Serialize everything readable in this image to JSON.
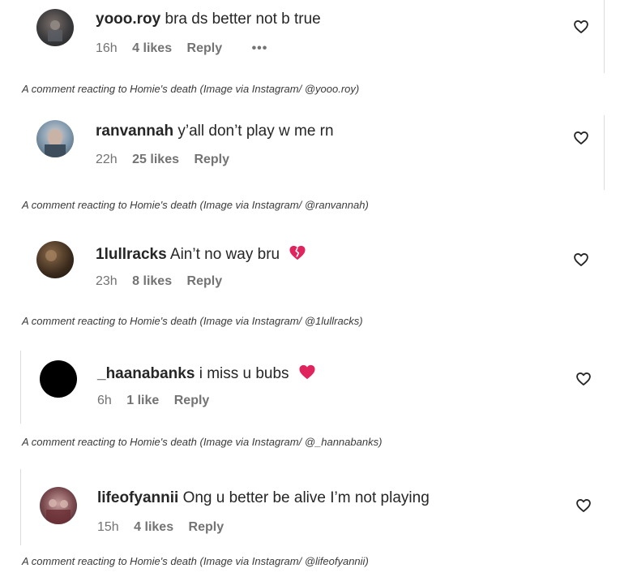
{
  "comments": [
    {
      "username": "yooo.roy",
      "text": "bra ds better not b true",
      "time": "16h",
      "likes": "4 likes",
      "reply": "Reply",
      "more": "•••",
      "avatar": "avatar-yooo-roy",
      "emoji": ""
    },
    {
      "username": "ranvannah",
      "text": "y’all don’t play w me rn",
      "time": "22h",
      "likes": "25 likes",
      "reply": "Reply",
      "more": "",
      "avatar": "avatar-ranvannah",
      "emoji": ""
    },
    {
      "username": "1lullracks",
      "text": "Ain’t no way bru",
      "time": "23h",
      "likes": "8 likes",
      "reply": "Reply",
      "more": "",
      "avatar": "avatar-1lullracks",
      "emoji": "broken-heart"
    },
    {
      "username": "_haanabanks",
      "text": "i miss u bubs",
      "time": "6h",
      "likes": "1 like",
      "reply": "Reply",
      "more": "",
      "avatar": "avatar-haanabanks",
      "emoji": "red-heart"
    },
    {
      "username": "lifeofyannii",
      "text": "Ong u better be alive I’m not playing",
      "time": "15h",
      "likes": "4 likes",
      "reply": "Reply",
      "more": "",
      "avatar": "avatar-lifeofyannii",
      "emoji": ""
    }
  ],
  "captions": [
    "A comment reacting to Homie's death (Image via Instagram/ @yooo.roy)",
    "A comment reacting to Homie's death (Image via Instagram/ @ranvannah)",
    "A comment reacting to Homie's death (Image via Instagram/ @1lullracks)",
    "A comment reacting to Homie's death (Image via Instagram/ @_hannabanks)",
    "A comment reacting to Homie's death (Image via Instagram/ @lifeofyannii)"
  ],
  "icons": {
    "like": "heart-outline-icon"
  },
  "colors": {
    "text": "#262626",
    "meta": "#737373",
    "emoji_heart": "#e0245e"
  }
}
